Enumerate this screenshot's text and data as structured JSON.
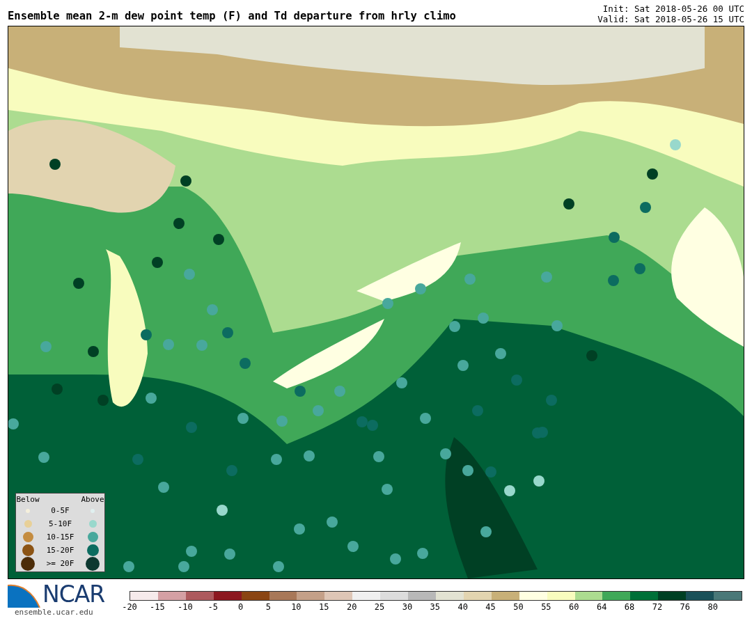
{
  "title": "Ensemble mean 2-m dew point temp (F) and Td departure from hrly climo",
  "init": "Init: Sat 2018-05-26 00 UTC",
  "valid": "Valid: Sat 2018-05-26 15 UTC",
  "legend": {
    "below_heading": "Below",
    "above_heading": "Above",
    "rows": [
      {
        "label": "0-5F",
        "below": {
          "color": "#f5f0dc"
        },
        "above": {
          "color": "#e0f0f0"
        }
      },
      {
        "label": "5-10F",
        "below": {
          "color": "#e8d098"
        },
        "above": {
          "color": "#98d8cc"
        }
      },
      {
        "label": "10-15F",
        "below": {
          "color": "#c48c40"
        },
        "above": {
          "color": "#48a89c"
        }
      },
      {
        "label": "15-20F",
        "below": {
          "color": "#8c5414"
        },
        "above": {
          "color": "#0c6c60"
        }
      },
      {
        "label": ">= 20F",
        "below": {
          "color": "#4c2c08"
        },
        "above": {
          "color": "#0c3830"
        }
      }
    ]
  },
  "logo": {
    "text": "NCAR",
    "url": "ensemble.ucar.edu"
  },
  "colorbar": {
    "segments": [
      {
        "color": "#f6eaeb"
      },
      {
        "color": "#d4a0a4"
      },
      {
        "color": "#ad5a5e"
      },
      {
        "color": "#8c1820"
      },
      {
        "color": "#8a4512"
      },
      {
        "color": "#a87858"
      },
      {
        "color": "#c4a088"
      },
      {
        "color": "#dec6b6"
      },
      {
        "color": "#f0f0f0"
      },
      {
        "color": "#dcdcdc"
      },
      {
        "color": "#b8b8b8"
      },
      {
        "color": "#e2e2d2"
      },
      {
        "color": "#e2d4b0"
      },
      {
        "color": "#c8b078"
      },
      {
        "color": "#ffffe2"
      },
      {
        "color": "#f8fcbe"
      },
      {
        "color": "#acdc90"
      },
      {
        "color": "#40a858"
      },
      {
        "color": "#007038"
      },
      {
        "color": "#004024"
      },
      {
        "color": "#1a5058"
      },
      {
        "color": "#4a7878"
      }
    ],
    "ticks": [
      "-20",
      "-15",
      "-10",
      "-5",
      "0",
      "5",
      "10",
      "15",
      "20",
      "25",
      "30",
      "35",
      "40",
      "45",
      "50",
      "55",
      "60",
      "64",
      "68",
      "72",
      "76",
      "80"
    ]
  }
}
